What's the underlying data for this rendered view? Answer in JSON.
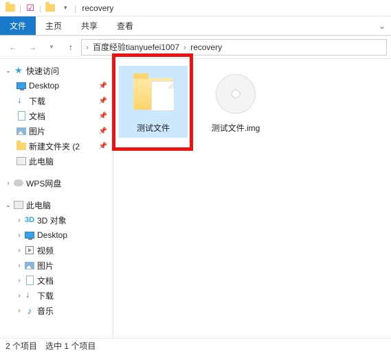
{
  "titlebar": {
    "title": "recovery"
  },
  "ribbon": {
    "file": "文件",
    "tabs": [
      "主页",
      "共享",
      "查看"
    ]
  },
  "breadcrumb": {
    "items": [
      "百度经验tianyuefei1007",
      "recovery"
    ]
  },
  "sidebar": {
    "quickAccess": "快速访问",
    "quick": [
      {
        "label": "Desktop",
        "icon": "monitor",
        "pinned": true
      },
      {
        "label": "下载",
        "icon": "download",
        "pinned": true
      },
      {
        "label": "文档",
        "icon": "doc",
        "pinned": true
      },
      {
        "label": "图片",
        "icon": "pic",
        "pinned": true
      },
      {
        "label": "新建文件夹 (2",
        "icon": "folder",
        "pinned": true
      },
      {
        "label": "此电脑",
        "icon": "pc",
        "pinned": false
      }
    ],
    "wps": "WPS网盘",
    "thisPc": "此电脑",
    "pcItems": [
      {
        "label": "3D 对象",
        "icon": "3d"
      },
      {
        "label": "Desktop",
        "icon": "monitor"
      },
      {
        "label": "视频",
        "icon": "video"
      },
      {
        "label": "图片",
        "icon": "pic"
      },
      {
        "label": "文档",
        "icon": "doc"
      },
      {
        "label": "下载",
        "icon": "download"
      },
      {
        "label": "音乐",
        "icon": "music"
      }
    ]
  },
  "content": {
    "items": [
      {
        "name": "测试文件",
        "type": "folder",
        "selected": true,
        "highlighted": true
      },
      {
        "name": "测试文件.img",
        "type": "disc",
        "selected": false,
        "highlighted": false
      }
    ]
  },
  "statusbar": {
    "count": "2 个项目",
    "selected": "选中 1 个项目"
  }
}
